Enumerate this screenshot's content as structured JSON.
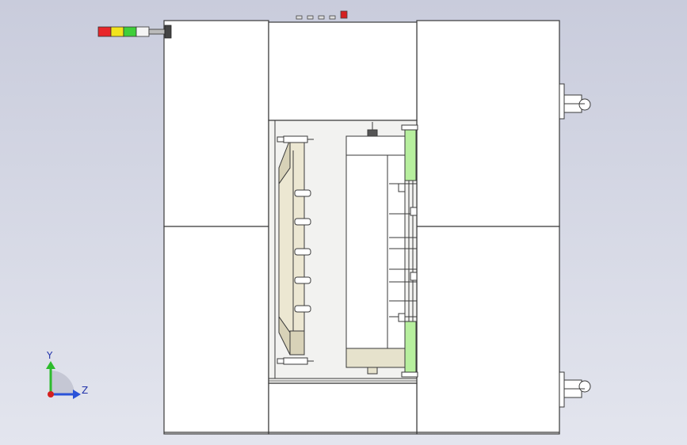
{
  "viewport": {
    "background_top": "#c9ccdc",
    "background_bottom": "#e3e5ee"
  },
  "model": {
    "line_color": "#3a3a3a",
    "panel_fill": "#ffffff",
    "cavity_fill": "#f2f2f0",
    "frame_fill": "#ece7d2",
    "frame_shade": "#d8d2b8",
    "roller_fill": "#b7ef9e",
    "base_fill": "#e6e2cc"
  },
  "signal_tower": {
    "segments": [
      "red",
      "yellow",
      "green",
      "white"
    ],
    "colors": {
      "red": "#e8262a",
      "yellow": "#f2e41c",
      "green": "#3fcf3a",
      "white": "#f4f4f4"
    }
  },
  "triad": {
    "y_label": "Y",
    "z_label": "Z",
    "y_color": "#2dbb2d",
    "z_color": "#2a52d8",
    "x_color": "#d42020"
  }
}
